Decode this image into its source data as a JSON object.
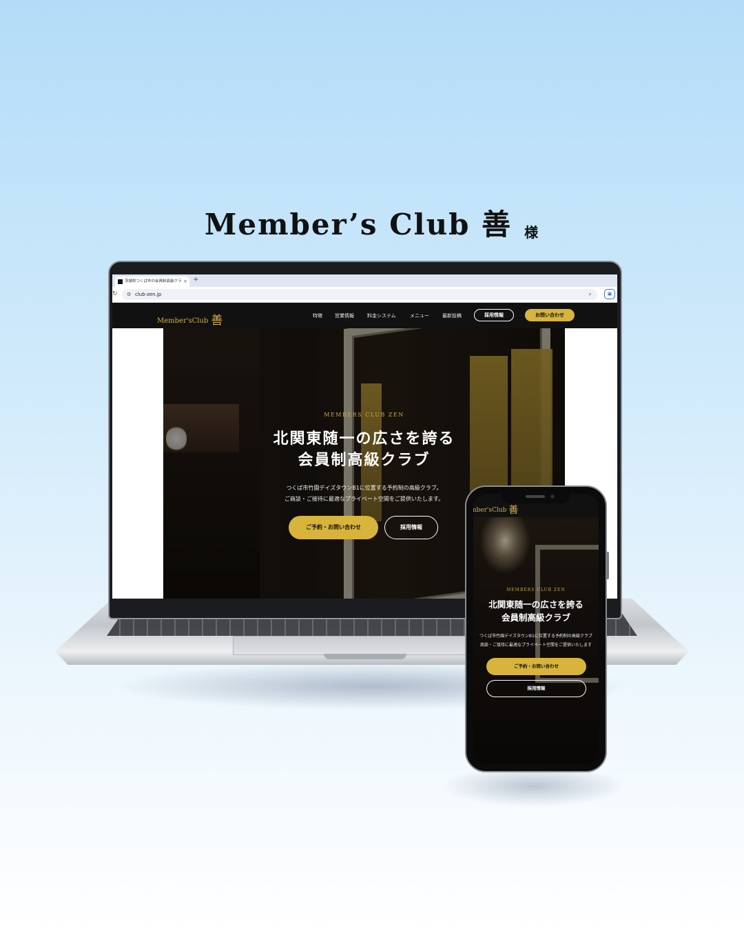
{
  "headline": {
    "title": "Member’s Club 善",
    "honorific": "様"
  },
  "browser": {
    "tab_title": "茨城県つくば市の会員制高級クラ",
    "tab_close": "×",
    "new_tab": "+",
    "url": "club-zen.jp"
  },
  "site": {
    "logo_text": "Member'sClub",
    "logo_kanji": "善",
    "nav": [
      "特徴",
      "営業情報",
      "料金システム",
      "メニュー",
      "最新投稿"
    ],
    "nav_recruit": "採用情報",
    "nav_contact": "お問い合わせ",
    "hero_sub": "MEMBERS CLUB ZEN",
    "hero_title_line1": "北関東随一の広さを誇る",
    "hero_title_line2": "会員制高級クラブ",
    "hero_desc_line1": "つくば市竹園デイズタウンB1に位置する予約制の高級クラブ。",
    "hero_desc_line2": "ご商談・ご接待に最適なプライベート空間をご提供いたします。",
    "btn_reserve": "ご予約・お問い合わせ",
    "btn_recruit": "採用情報"
  },
  "mobile": {
    "logo_text": "mber'sClub",
    "logo_kanji": "善",
    "hero_sub": "MEMBERS CLUB ZEN",
    "hero_title_line1": "北関東随一の広さを誇る",
    "hero_title_line2": "会員制高級クラブ",
    "hero_desc_line1": "つくば市竹園デイズタウンB1に位置する予約制の高級クラブ",
    "hero_desc_line2": "商談・ご接待に最適なプライベート空間をご提供いたします",
    "btn_reserve": "ご予約・お問い合わせ",
    "btn_recruit": "採用情報"
  },
  "colors": {
    "accent_gold": "#d8b43c",
    "nav_bg": "#111111",
    "bg_top": "#b3dcf8"
  }
}
